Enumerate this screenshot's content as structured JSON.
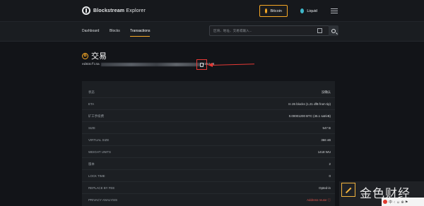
{
  "header": {
    "brand_bold": "Blockstream",
    "brand_light": " Explorer",
    "networks": [
      {
        "label": "Bitcoin",
        "icon": "bitcoin-coin-icon",
        "color": "#f7a825",
        "active": true
      },
      {
        "label": "Liquid",
        "icon": "liquid-drop-icon",
        "color": "#3fb7c9",
        "active": false
      }
    ],
    "menu_icon": "hamburger-menu-icon"
  },
  "nav": {
    "items": [
      {
        "label": "Dashboard",
        "active": false
      },
      {
        "label": "Blocks",
        "active": false
      },
      {
        "label": "Transactions",
        "active": true
      }
    ],
    "search_placeholder": "区块、地址、交易或输入...",
    "accent": "#f7a825"
  },
  "transaction": {
    "title": "交易",
    "badge": "B",
    "txid_prefix": "ed83cfc4a",
    "txid_suffix": "23a1e6"
  },
  "details": [
    {
      "label": "状态",
      "value": "没确认"
    },
    {
      "label": "ETA",
      "value": "In 26 blocks (1.21 dfB from tip)"
    },
    {
      "label": "矿工手续费",
      "value": "0.00001200 BTC (45.1 sat/vB)"
    },
    {
      "label": "SIZE",
      "value": "547 B"
    },
    {
      "label": "VIRTUAL SIZE",
      "value": "366 vB"
    },
    {
      "label": "WEIGHT UNITS",
      "value": "1418 WU"
    },
    {
      "label": "版本",
      "value": "2"
    },
    {
      "label": "LOCK TIME",
      "value": "0"
    },
    {
      "label": "REPLACE BY FEE",
      "value": "Opted-in"
    },
    {
      "label": "PRIVACY ANALYSIS",
      "value": "Address reuse ⓘ"
    }
  ],
  "watermark": {
    "text": "金色财经",
    "strip": "中 ·: ☺ ⊕ ⚑"
  }
}
